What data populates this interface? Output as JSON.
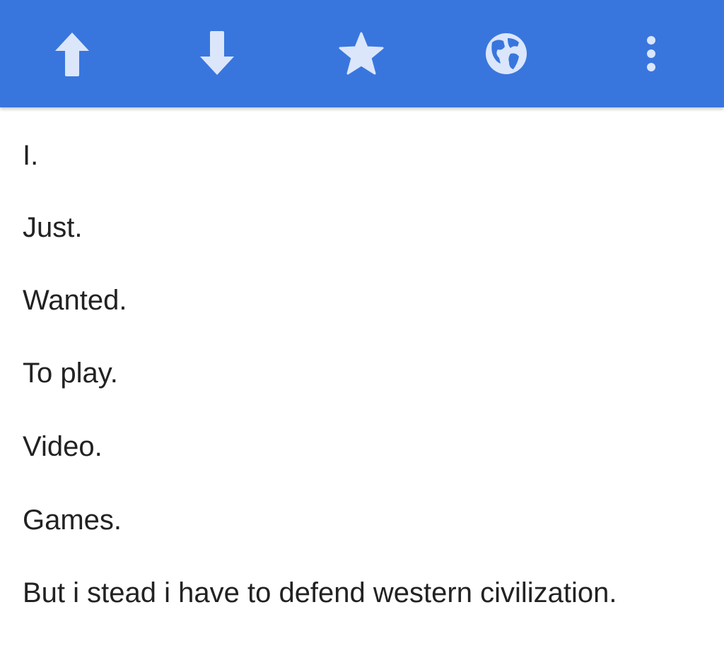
{
  "toolbar": {
    "background": "#3876de",
    "icon_color": "#dbe6fb",
    "actions": [
      {
        "name": "upvote",
        "icon": "arrow-up-icon"
      },
      {
        "name": "downvote",
        "icon": "arrow-down-icon"
      },
      {
        "name": "save",
        "icon": "star-icon"
      },
      {
        "name": "open-in-browser",
        "icon": "globe-icon"
      },
      {
        "name": "more",
        "icon": "more-vertical-icon"
      }
    ]
  },
  "content": {
    "lines": [
      "I.",
      "Just.",
      "Wanted.",
      "To play.",
      "Video.",
      "Games.",
      "But i stead i have to defend western civilization."
    ]
  }
}
